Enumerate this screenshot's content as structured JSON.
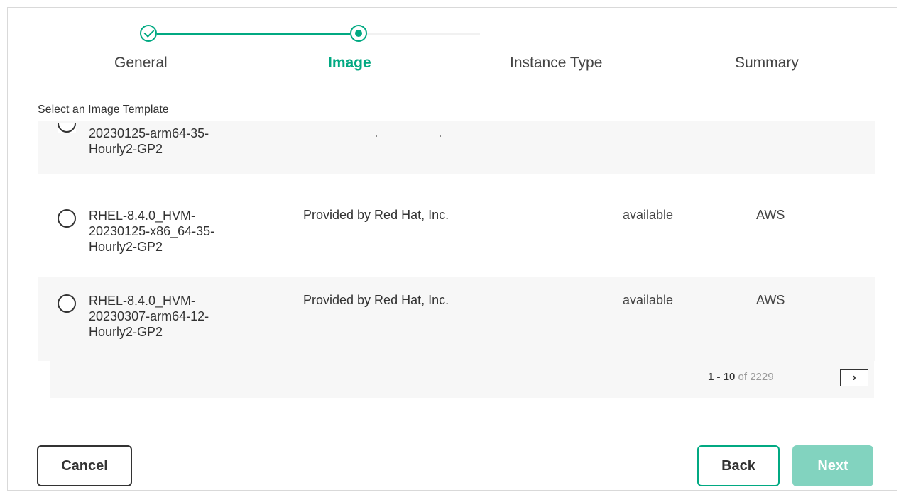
{
  "stepper": {
    "steps": [
      {
        "label": "General",
        "state": "complete"
      },
      {
        "label": "Image",
        "state": "current"
      },
      {
        "label": "Instance Type",
        "state": "pending"
      },
      {
        "label": "Summary",
        "state": "pending"
      }
    ]
  },
  "section": {
    "title": "Select an Image Template"
  },
  "rows": [
    {
      "name": "20230125-arm64-35-\nHourly2-GP2",
      "description": "",
      "status": "",
      "provider": ""
    },
    {
      "name": "RHEL-8.4.0_HVM-\n20230125-x86_64-35-\nHourly2-GP2",
      "description": "Provided by Red Hat, Inc.",
      "status": "available",
      "provider": "AWS"
    },
    {
      "name": "RHEL-8.4.0_HVM-\n20230307-arm64-12-\nHourly2-GP2",
      "description": "Provided by Red Hat, Inc.",
      "status": "available",
      "provider": "AWS"
    }
  ],
  "pagination": {
    "range": "1 - 10",
    "of_total": "of 2229",
    "next_icon": "chevron-right-icon"
  },
  "footer": {
    "cancel_label": "Cancel",
    "back_label": "Back",
    "next_label": "Next"
  },
  "colors": {
    "accent": "#01a982",
    "next_disabled": "#82d3bf"
  }
}
